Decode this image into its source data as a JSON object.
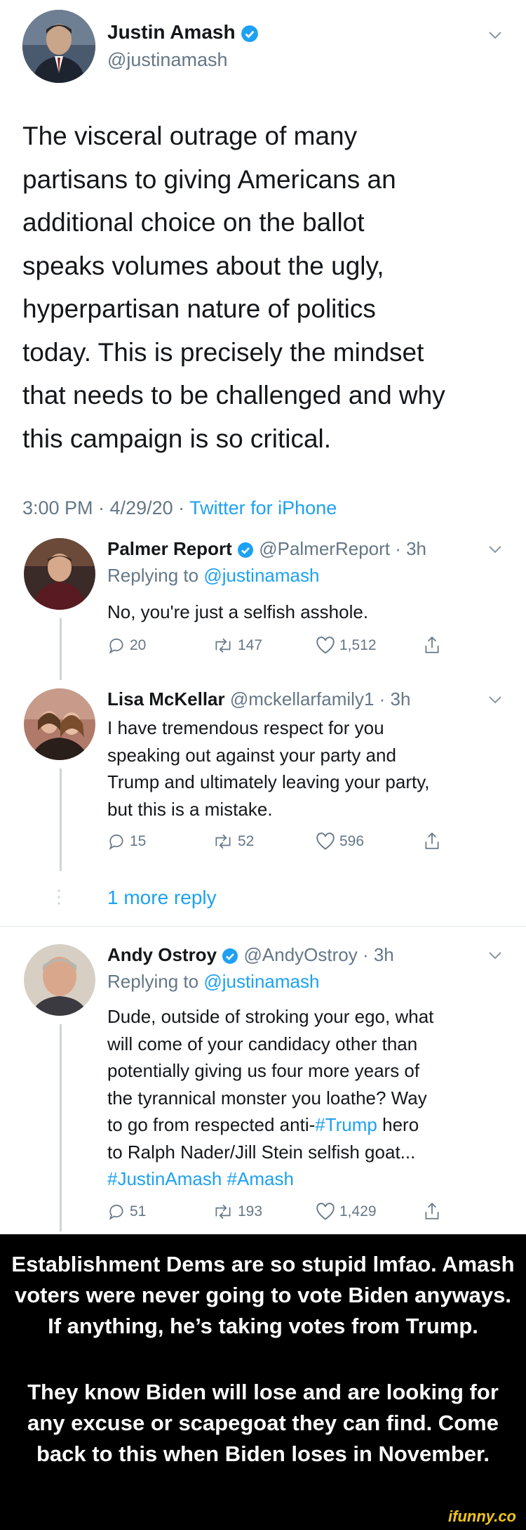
{
  "main_tweet": {
    "name": "Justin Amash",
    "handle": "@justinamash",
    "text": "The visceral outrage of many\npartisans to giving Americans an\nadditional choice on the ballot\nspeaks volumes about the ugly,\nhyperpartisan nature of politics\ntoday. This is precisely the mindset\nthat needs to be challenged and why\nthis campaign is so critical.",
    "time": "3:00 PM · 4/29/20 · ",
    "source": "Twitter for iPhone",
    "avatar_icon": "person-avatar-icon"
  },
  "replies": [
    {
      "name": "Palmer Report",
      "handle_time": "@PalmerReport · 3h",
      "replying_prefix": "Replying to ",
      "replying_to": "@justinamash",
      "text": "No, you're just a selfish asshole.",
      "replies": "20",
      "retweets": "147",
      "likes": "1,512"
    },
    {
      "name": "Lisa McKellar",
      "handle_time": "@mckellarfamily1 · 3h",
      "text_lines": [
        "I have tremendous respect for you",
        "speaking out against your party and",
        "Trump and ultimately leaving your party,",
        "but this is a mistake."
      ],
      "replies": "15",
      "retweets": "52",
      "likes": "596"
    },
    {
      "name": "Andy Ostroy",
      "handle_time": "@AndyOstroy · 3h",
      "replying_prefix": "Replying to ",
      "replying_to": "@justinamash",
      "text_lines": [
        "Dude, outside of stroking your ego, what",
        "will come of your candidacy other than",
        "potentially giving us four more years of",
        "the tyrannical monster you loathe? Way"
      ],
      "line5_pre": "to go from respected anti-",
      "line5_tag": "#Trump",
      "line5_post": " hero",
      "line6": "to Ralph Nader/Jill Stein selfish goat...",
      "tags": "#JustinAmash #Amash",
      "replies": "51",
      "retweets": "193",
      "likes": "1,429"
    }
  ],
  "more_reply": "1 more reply",
  "caption": {
    "p1": "Establishment Dems are so stupid lmfao. Amash voters were never going to vote Biden anyways. If anything, he’s taking votes from Trump.",
    "p2": "They know Biden will lose and are looking for any excuse or scapegoat they can find. Come back to this when Biden loses in November."
  },
  "watermark": "ifunny.co",
  "colors": {
    "link": "#1da1f2",
    "muted": "#657786",
    "text": "#14171a",
    "caption_bg": "#000000",
    "watermark": "#f0c419"
  }
}
